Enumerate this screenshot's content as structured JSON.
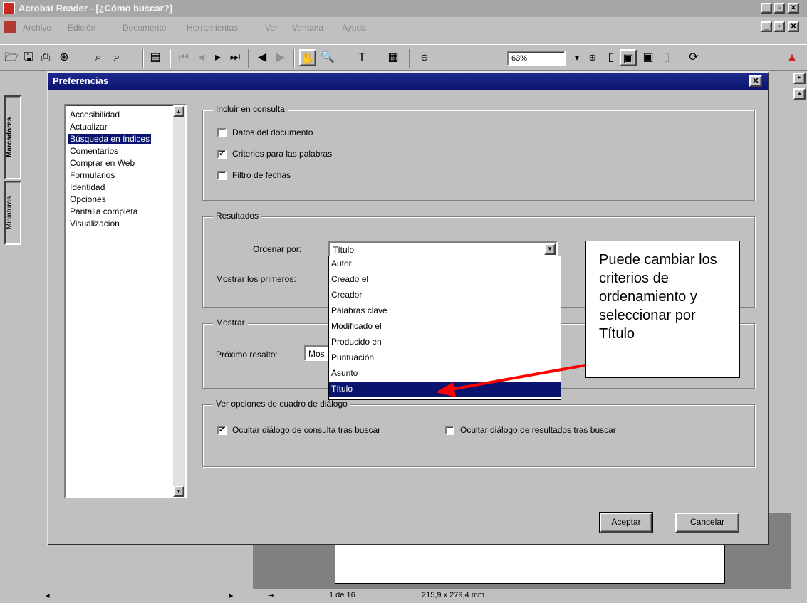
{
  "app": {
    "title": "Acrobat Reader - [¿Cómo buscar?]",
    "menus": [
      "Archivo",
      "Edición",
      "Documento",
      "Herramientas",
      "Ver",
      "Ventana",
      "Ayuda"
    ],
    "zoom": "63%",
    "side_tabs": [
      "Marcadores",
      "Miniaturas"
    ],
    "status": {
      "page": "1 de 16",
      "size": "215,9 x 279,4 mm"
    }
  },
  "dialog": {
    "title": "Preferencias",
    "categories": [
      "Accesibilidad",
      "Actualizar",
      "Búsqueda en índices",
      "Comentarios",
      "Comprar en Web",
      "Formularios",
      "Identidad",
      "Opciones",
      "Pantalla completa",
      "Visualización"
    ],
    "selected_category": "Búsqueda en índices",
    "group_incluir": {
      "title": "Incluir en consulta",
      "options": [
        {
          "label": "Datos del documento",
          "checked": false
        },
        {
          "label": "Criterios para las palabras",
          "checked": true
        },
        {
          "label": "Filtro de fechas",
          "checked": false
        }
      ]
    },
    "group_resultados": {
      "title": "Resultados",
      "sort_label": "Ordenar por:",
      "sort_value": "Título",
      "show_first_label": "Mostrar los primeros:",
      "sort_options": [
        "Autor",
        "Creado el",
        "Creador",
        "Palabras clave",
        "Modificado el",
        "Producido en",
        "Puntuación",
        "Asunto",
        "Título"
      ],
      "sort_selected": "Título"
    },
    "group_mostrar": {
      "title": "Mostrar",
      "next_label": "Próximo resalto:",
      "next_value": "Mos"
    },
    "group_ver": {
      "title": "Ver opciones de cuadro de diálogo",
      "options": [
        {
          "label": "Ocultar diálogo de consulta tras buscar",
          "checked": true
        },
        {
          "label": "Ocultar diálogo de resultados tras buscar",
          "checked": false
        }
      ]
    },
    "buttons": {
      "ok": "Aceptar",
      "cancel": "Cancelar"
    }
  },
  "callout": {
    "text": "Puede cambiar los criterios de ordenamiento y seleccionar por Título"
  }
}
